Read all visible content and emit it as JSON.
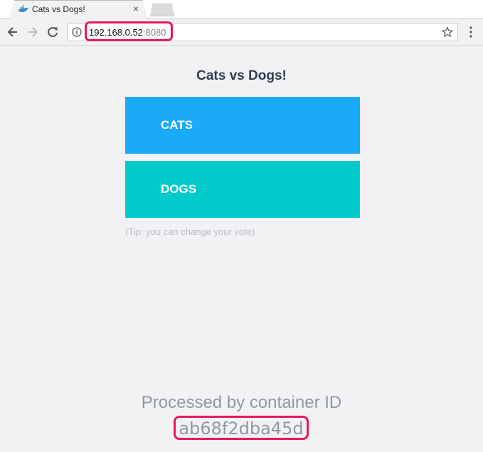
{
  "browser": {
    "tab": {
      "title": "Cats vs Dogs!",
      "favicon": "docker-whale-icon",
      "close": "×"
    },
    "address_bar": {
      "host": "192.168.0.52",
      "port": ":8080"
    },
    "icons": {
      "back": "arrow-left-icon",
      "forward": "arrow-right-icon",
      "reload": "reload-icon",
      "info": "info-icon",
      "bookmark": "star-icon",
      "menu": "kebab-menu-icon"
    }
  },
  "page": {
    "title": "Cats vs Dogs!",
    "options": [
      {
        "label": "CATS",
        "color": "#1aaaf8"
      },
      {
        "label": "DOGS",
        "color": "#00cbca"
      }
    ],
    "tip": "(Tip: you can change your vote)",
    "processed_label": "Processed by container ID",
    "container_id": "ab68f2dba45d"
  },
  "colors": {
    "highlight": "#e8175d",
    "title_text": "#2d3e50",
    "muted_text": "#8d99a4",
    "background": "#f2f2f4"
  }
}
